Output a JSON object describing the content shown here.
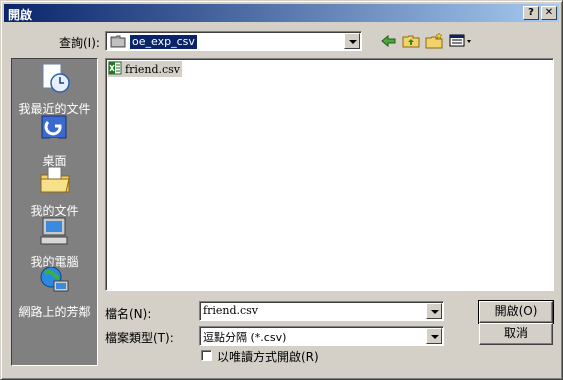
{
  "window": {
    "title": "開啟",
    "help_label": "?",
    "close_label": "✕"
  },
  "lookin": {
    "label": "查詢(I):",
    "value": "oe_exp_csv"
  },
  "toolbar": [
    "back-icon",
    "up-folder-icon",
    "new-folder-icon",
    "view-menu-icon"
  ],
  "places": [
    {
      "label": "我最近的文件",
      "icon": "recent-documents-icon"
    },
    {
      "label": "桌面",
      "icon": "desktop-icon"
    },
    {
      "label": "我的文件",
      "icon": "my-documents-icon"
    },
    {
      "label": "我的電腦",
      "icon": "my-computer-icon"
    },
    {
      "label": "網路上的芳鄰",
      "icon": "network-places-icon"
    }
  ],
  "files": [
    {
      "name": "friend.csv",
      "icon": "csv-file-icon"
    }
  ],
  "filename": {
    "label": "檔名(N):",
    "value": "friend.csv"
  },
  "filetype": {
    "label": "檔案類型(T):",
    "value": "逗點分隔 (*.csv)"
  },
  "readonly": {
    "label": "以唯讀方式開啟(R)",
    "checked": false
  },
  "buttons": {
    "open": "開啟(O)",
    "cancel": "取消"
  },
  "colors": {
    "title_start": "#0a246a",
    "title_end": "#a6caf0",
    "face": "#d4d0c8",
    "places_bg": "#808080"
  }
}
